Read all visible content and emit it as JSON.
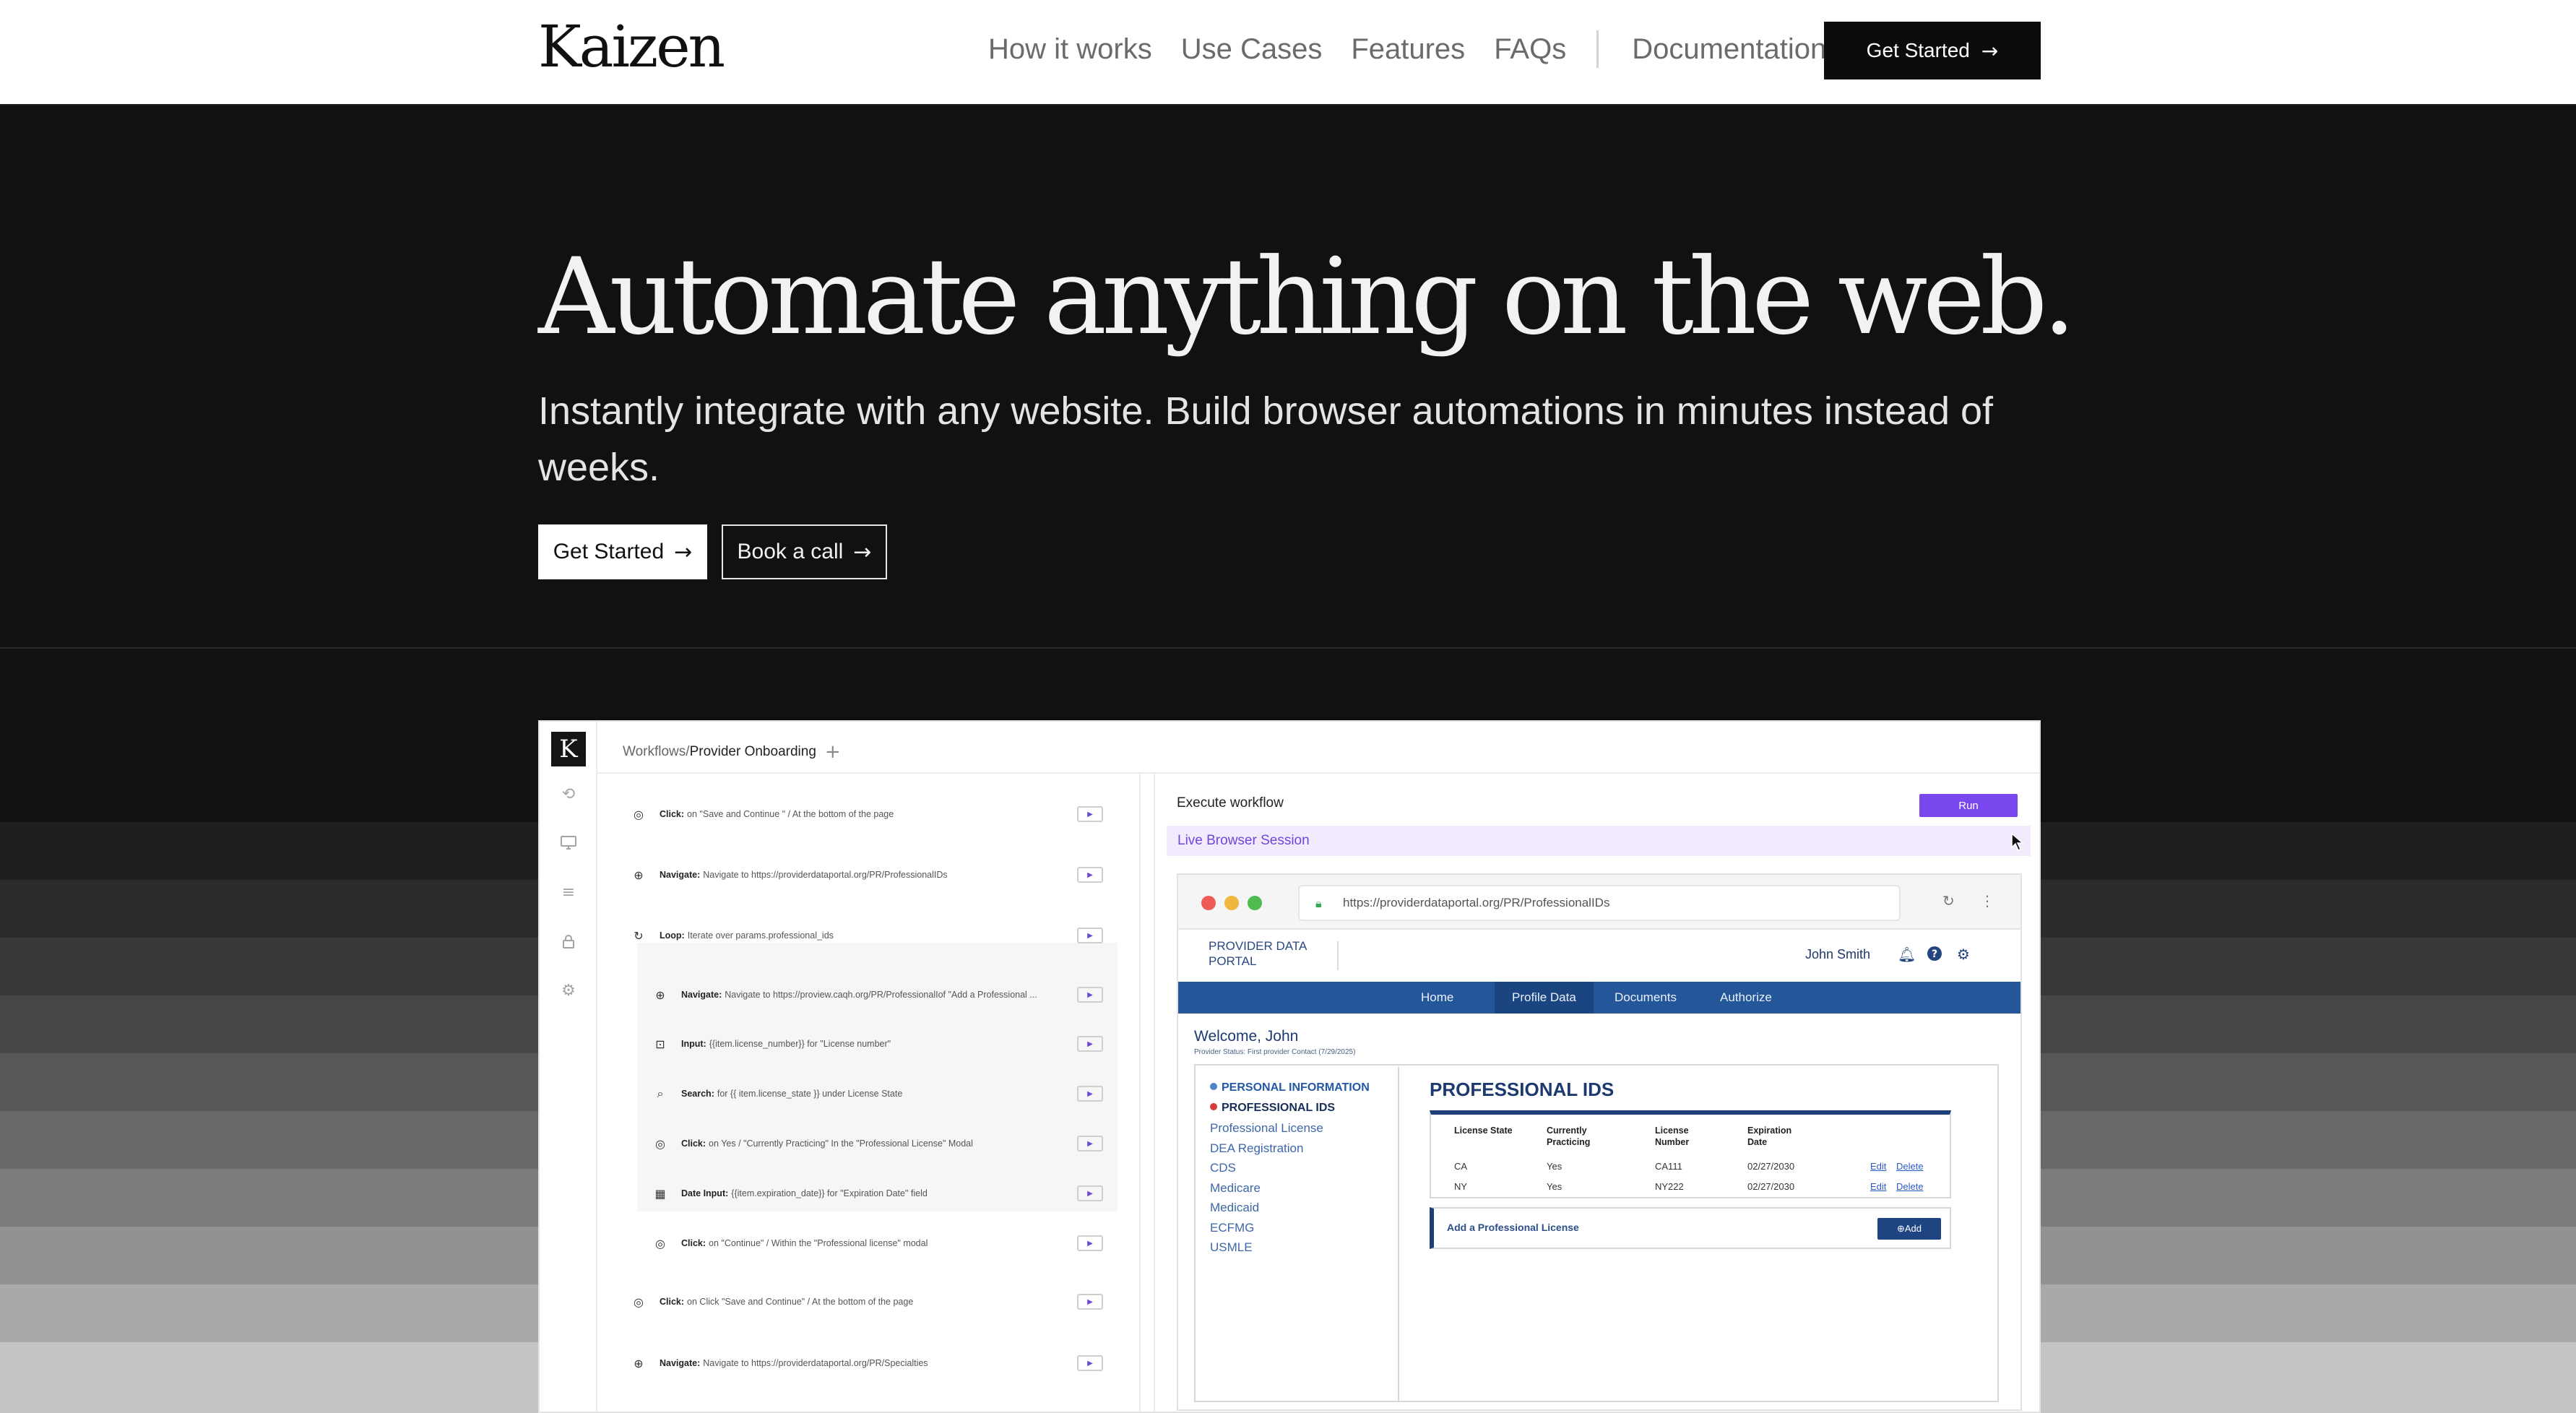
{
  "nav": {
    "logo": "Kaizen",
    "links": [
      "How it works",
      "Use Cases",
      "Features",
      "FAQs"
    ],
    "docs": "Documentation",
    "cta": "Get Started",
    "arrow": "→"
  },
  "hero": {
    "title": "Automate anything on the web.",
    "subtitle": "Instantly integrate with any website. Build browser automations in minutes instead of weeks.",
    "primary_cta": "Get Started",
    "secondary_cta": "Book a call",
    "arrow": "→"
  },
  "app": {
    "logo": "K",
    "crumb_prefix": "Workflows/",
    "crumb_current": "Provider Onboarding",
    "crumb_add": "+",
    "steps": [
      {
        "icon": "cursor-click-icon",
        "glyph": "◎",
        "kind": "Click:",
        "text": "on \"Save and Continue \" / At the bottom of the page"
      },
      {
        "icon": "globe-icon",
        "glyph": "⊕",
        "kind": "Navigate:",
        "text": "Navigate to https://providerdataportal.org/PR/ProfessionalIDs"
      },
      {
        "icon": "loop-icon",
        "glyph": "↻",
        "kind": "Loop:",
        "text": "Iterate over params.professional_ids"
      },
      {
        "icon": "globe-icon",
        "glyph": "⊕",
        "kind": "Navigate:",
        "text": "Navigate to https://proview.caqh.org/PR/ProfessionalIof \"Add a Professional ..."
      },
      {
        "icon": "input-icon",
        "glyph": "⊡",
        "kind": "Input:",
        "text": "{{item.license_number}} for \"License number\""
      },
      {
        "icon": "search-icon",
        "glyph": "⌕",
        "kind": "Search:",
        "text": "for {{ item.license_state }} under License State"
      },
      {
        "icon": "cursor-click-icon",
        "glyph": "◎",
        "kind": "Click:",
        "text": "on Yes / \"Currently Practicing\" In the \"Professional License\" Modal"
      },
      {
        "icon": "calendar-icon",
        "glyph": "▦",
        "kind": "Date Input:",
        "text": "{{item.expiration_date}} for \"Expiration Date\" field"
      },
      {
        "icon": "cursor-click-icon",
        "glyph": "◎",
        "kind": "Click:",
        "text": "on \"Continue\" / Within the \"Professional license\" modal"
      },
      {
        "icon": "cursor-click-icon",
        "glyph": "◎",
        "kind": "Click:",
        "text": "on Click \"Save and Continue\" / At the bottom of the page"
      },
      {
        "icon": "globe-icon",
        "glyph": "⊕",
        "kind": "Navigate:",
        "text": "Navigate to https://providerdataportal.org/PR/Specialties"
      }
    ],
    "play_glyph": "▶",
    "execute_title": "Execute workflow",
    "run_label": "Run",
    "live_session": "Live Browser Session",
    "accent_color": "#7a46ee"
  },
  "browser": {
    "url": "https://providerdataportal.org/PR/ProfessionalIDs",
    "portal_name": "PROVIDER DATA PORTAL",
    "user": "John Smith",
    "tabs": [
      "Home",
      "Profile Data",
      "Documents",
      "Authorize"
    ],
    "welcome": "Welcome, John",
    "status": "Provider Status: First provider Contact (7/29/2025)",
    "sections": [
      {
        "label": "PERSONAL INFORMATION",
        "style": "strong",
        "bullet": "#4f83c9"
      },
      {
        "label": "PROFESSIONAL IDS",
        "style": "dark",
        "bullet": "#d83a3a"
      },
      {
        "label": "Professional License"
      },
      {
        "label": "DEA Registration"
      },
      {
        "label": "CDS"
      },
      {
        "label": "Medicare"
      },
      {
        "label": "Medicaid"
      },
      {
        "label": "ECFMG"
      },
      {
        "label": "USMLE"
      }
    ],
    "page_title": "PROFESSIONAL IDS",
    "table_headers": [
      "License State",
      "Currently Practicing",
      "License Number",
      "Expiration Date"
    ],
    "table_rows": [
      {
        "state": "CA",
        "practicing": "Yes",
        "number": "CA111",
        "expiration": "02/27/2030",
        "edit": "Edit",
        "delete": "Delete"
      },
      {
        "state": "NY",
        "practicing": "Yes",
        "number": "NY222",
        "expiration": "02/27/2030",
        "edit": "Edit",
        "delete": "Delete"
      }
    ],
    "add_label": "Add a Professional License",
    "add_button": "⊕Add",
    "brand_color": "#24569a"
  }
}
